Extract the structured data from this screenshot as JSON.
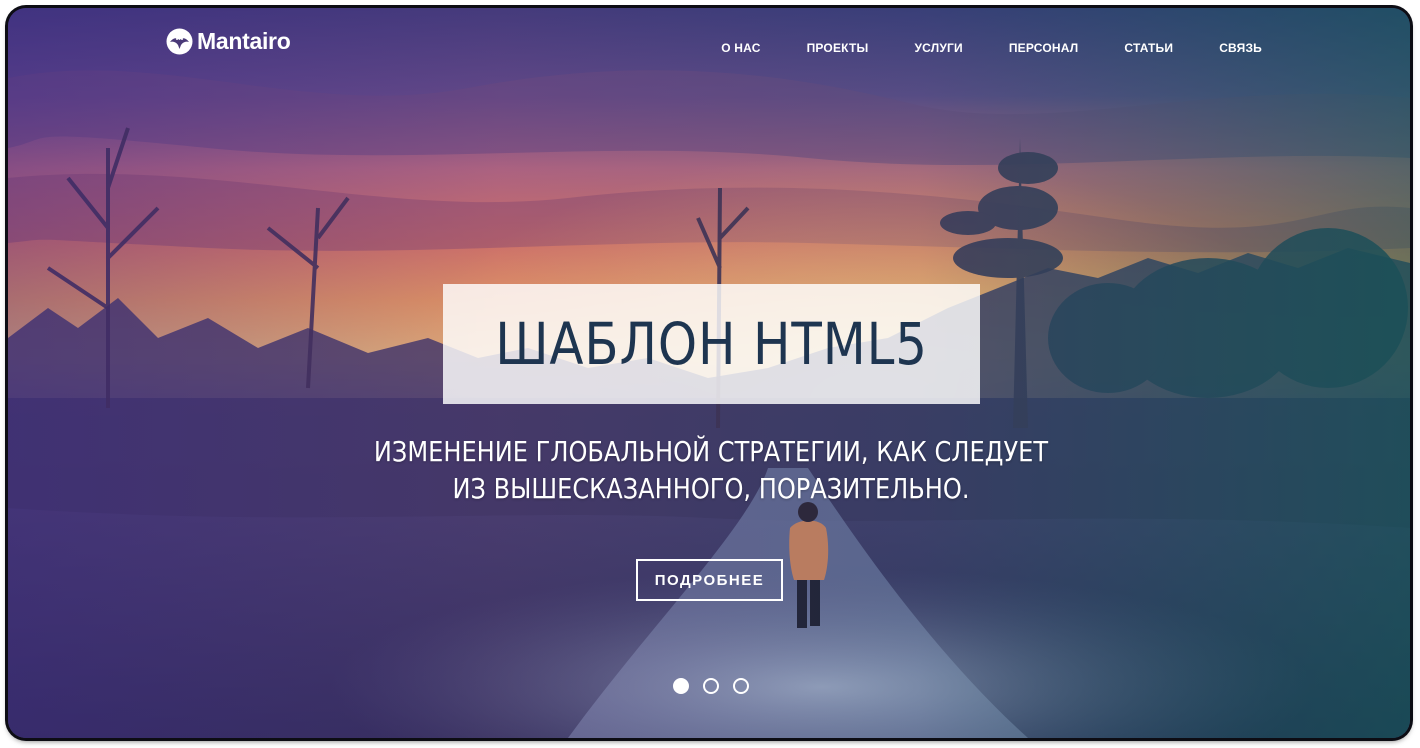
{
  "brand": {
    "name": "Mantairo",
    "icon": "manta-ray-logo-icon"
  },
  "nav": {
    "items": [
      {
        "label": "О НАС"
      },
      {
        "label": "ПРОЕКТЫ"
      },
      {
        "label": "УСЛУГИ"
      },
      {
        "label": "ПЕРСОНАЛ"
      },
      {
        "label": "СТАТЬИ"
      },
      {
        "label": "СВЯЗЬ"
      }
    ]
  },
  "hero": {
    "title": "ШАБЛОН HTML5",
    "subtitle_line1": "ИЗМЕНЕНИЕ ГЛОБАЛЬНОЙ СТРАТЕГИИ, КАК СЛЕДУЕТ",
    "subtitle_line2": "ИЗ ВЫШЕСКАЗАННОГО, ПОРАЗИТЕЛЬНО.",
    "button_label": "ПОДРОБНЕЕ",
    "background": "sunset-forest-path-photo"
  },
  "slider": {
    "slides_total": 3,
    "active_slide": 1
  },
  "colors": {
    "title_text": "#1e3550",
    "overlay_left": "#4a2a8a",
    "overlay_right": "#0a5f55"
  }
}
